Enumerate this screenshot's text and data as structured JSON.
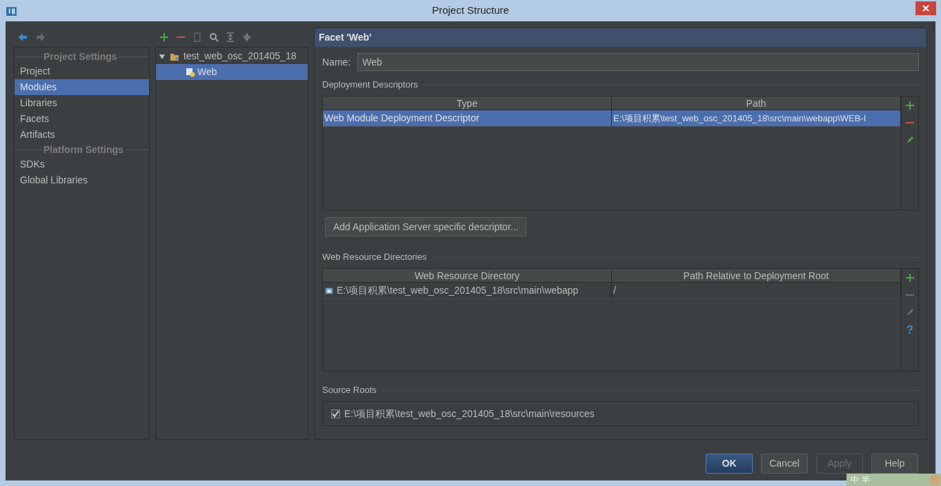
{
  "window": {
    "title": "Project Structure"
  },
  "sidebar": {
    "groups": [
      {
        "heading": "Project Settings",
        "items": [
          {
            "label": "Project",
            "selected": false
          },
          {
            "label": "Modules",
            "selected": true
          },
          {
            "label": "Libraries",
            "selected": false
          },
          {
            "label": "Facets",
            "selected": false
          },
          {
            "label": "Artifacts",
            "selected": false
          }
        ]
      },
      {
        "heading": "Platform Settings",
        "items": [
          {
            "label": "SDKs",
            "selected": false
          },
          {
            "label": "Global Libraries",
            "selected": false
          }
        ]
      }
    ]
  },
  "tree": {
    "items": [
      {
        "label": "test_web_osc_201405_18",
        "expanded": true,
        "selected": false,
        "children": [
          {
            "label": "Web",
            "selected": true
          }
        ]
      }
    ]
  },
  "facet": {
    "title": "Facet 'Web'",
    "name_label": "Name:",
    "name_value": "Web",
    "deployment_descriptors": {
      "title": "Deployment Descriptors",
      "columns": [
        "Type",
        "Path"
      ],
      "rows": [
        {
          "cells": [
            "Web Module Deployment Descriptor",
            "E:\\项目积累\\test_web_osc_201405_18\\src\\main\\webapp\\WEB-I"
          ],
          "selected": true
        }
      ]
    },
    "add_button": "Add Application Server specific descriptor...",
    "web_resource_directories": {
      "title": "Web Resource Directories",
      "columns": [
        "Web Resource Directory",
        "Path Relative to Deployment Root"
      ],
      "rows": [
        {
          "cells": [
            "E:\\项目积累\\test_web_osc_201405_18\\src\\main\\webapp",
            "/"
          ],
          "selected": false
        }
      ],
      "help": "?"
    },
    "source_roots": {
      "title": "Source Roots",
      "items": [
        {
          "label": "E:\\项目积累\\test_web_osc_201405_18\\src\\main\\resources",
          "checked": true
        }
      ]
    }
  },
  "buttons": [
    {
      "label": "OK",
      "kind": "default"
    },
    {
      "label": "Cancel",
      "kind": "normal"
    },
    {
      "label": "Apply",
      "kind": "disabled"
    },
    {
      "label": "Help",
      "kind": "normal"
    }
  ],
  "ime_bar": {
    "items": [
      "中",
      "半"
    ]
  }
}
